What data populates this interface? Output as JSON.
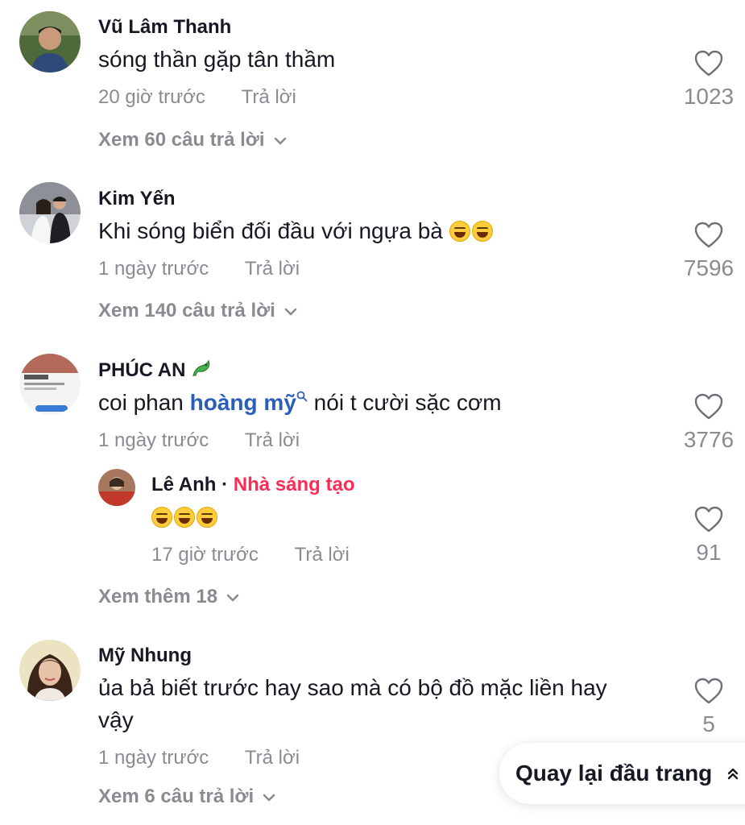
{
  "comments": [
    {
      "username": "Vũ Lâm Thanh",
      "text": "sóng thần gặp tân thầm",
      "time": "20 giờ trước",
      "reply_label": "Trả lời",
      "likes": "1023",
      "view_replies": "Xem 60 câu trả lời"
    },
    {
      "username": "Kim Yến",
      "text": "Khi sóng biển đối đầu với ngựa bà",
      "time": "1 ngày trước",
      "reply_label": "Trả lời",
      "likes": "7596",
      "view_replies": "Xem 140 câu trả lời"
    },
    {
      "username": "PHÚC AN",
      "text_before": "coi phan",
      "mention": "hoàng mỹ",
      "text_after": "nói t cười sặc cơm",
      "time": "1 ngày trước",
      "reply_label": "Trả lời",
      "likes": "3776",
      "reply": {
        "username": "Lê Anh",
        "separator": "·",
        "creator_tag": "Nhà sáng tạo",
        "time": "17 giờ trước",
        "reply_label": "Trả lời",
        "likes": "91"
      },
      "view_more": "Xem thêm 18"
    },
    {
      "username": "Mỹ Nhung",
      "text_line1": "ủa bả biết trước hay sao mà có bộ đồ mặc liền hay",
      "text_line2": "vậy",
      "time": "1 ngày trước",
      "reply_label": "Trả lời",
      "likes": "5",
      "view_replies": "Xem 6 câu trả lời"
    }
  ],
  "back_to_top": "Quay lại đầu trang",
  "colors": {
    "text": "#161823",
    "muted": "#8a8b91",
    "mention": "#2b5db9",
    "creator": "#fe2c55"
  }
}
